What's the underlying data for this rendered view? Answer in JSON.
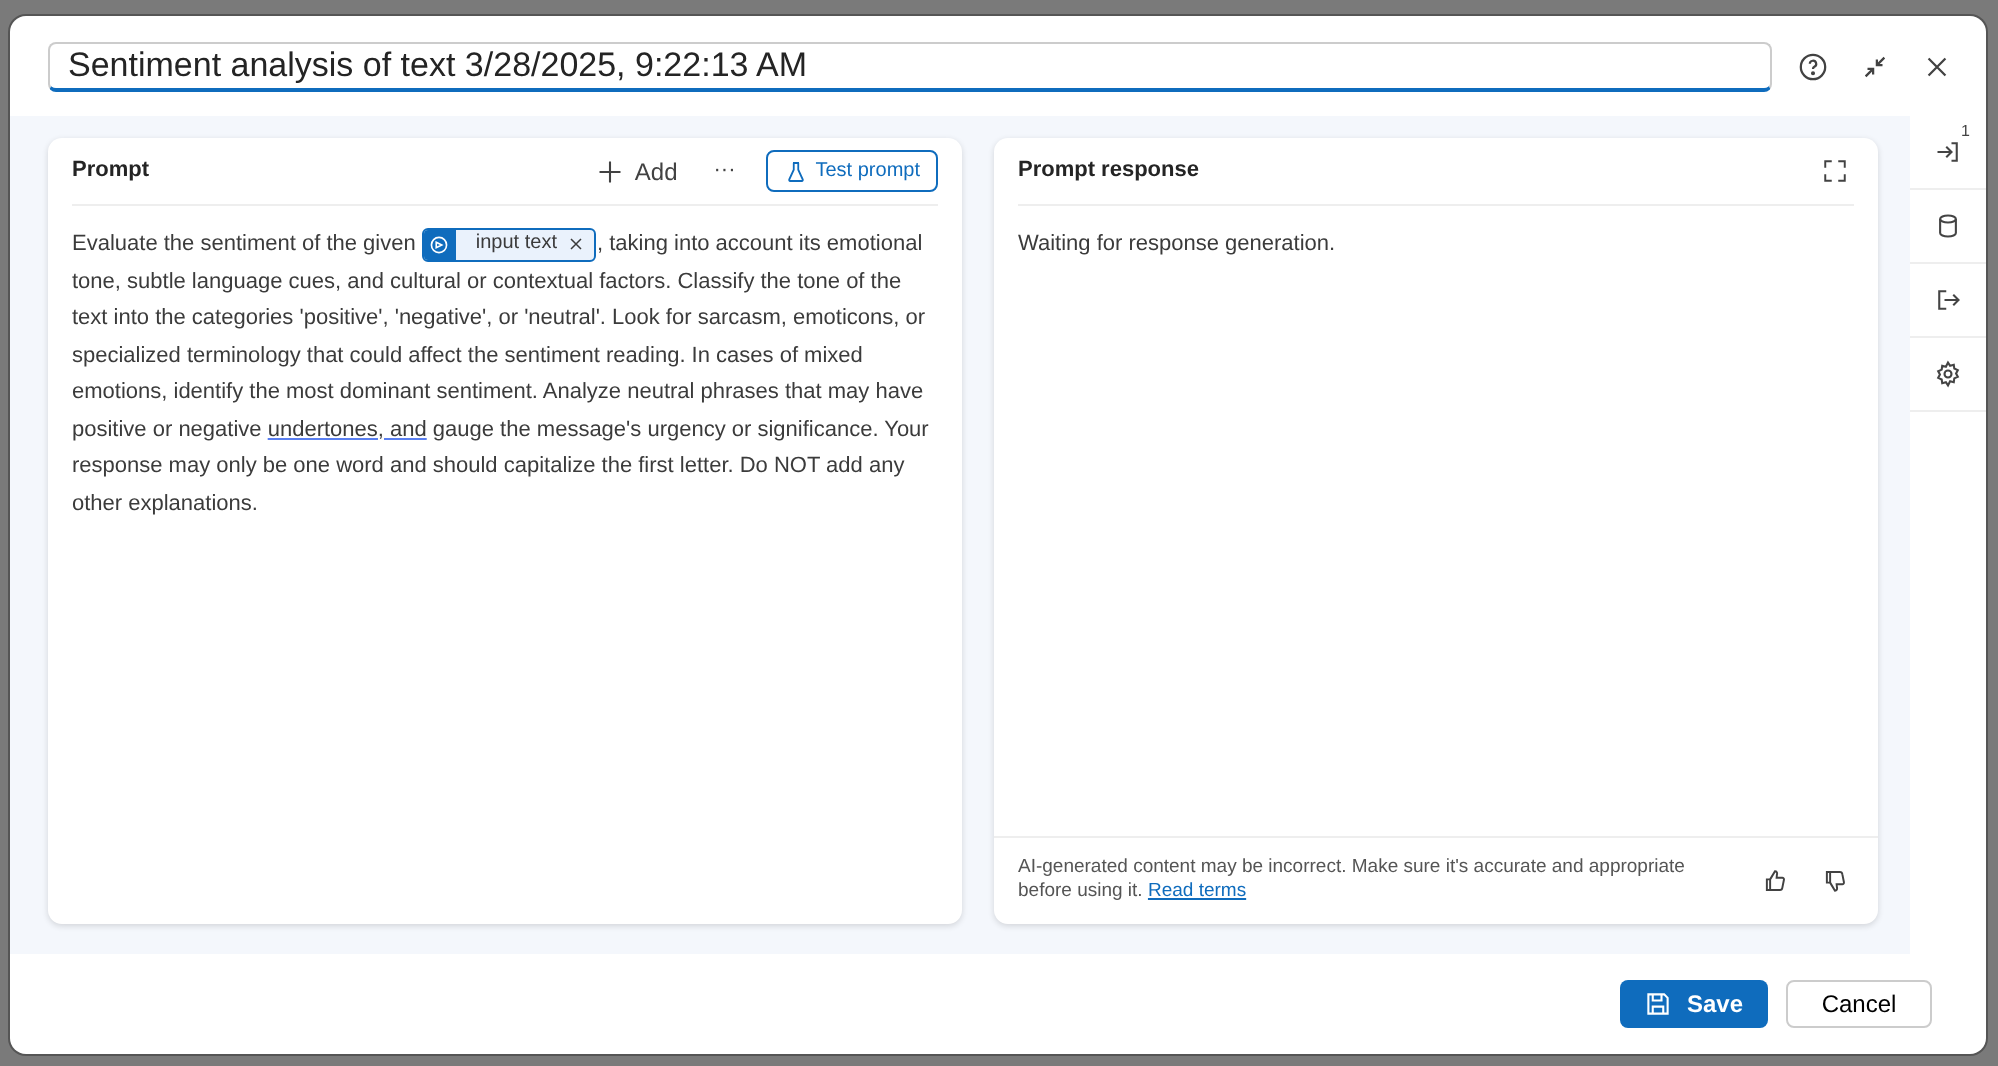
{
  "dialog": {
    "title_value": "Sentiment analysis of text 3/28/2025, 9:22:13 AM"
  },
  "prompt": {
    "title": "Prompt",
    "add_label": "Add",
    "more_label": "···",
    "test_label": "Test prompt",
    "text_before": "Evaluate the sentiment of the given ",
    "chip": "input text",
    "text_after": ", taking into account its emotional tone, subtle language cues, and cultural or contextual factors. Classify the tone of the text into the categories 'positive', 'negative', or 'neutral'. Look for sarcasm, emoticons, or specialized terminology that could affect the sentiment reading. In cases of mixed emotions, identify the most dominant sentiment. Analyze neutral phrases that may have positive or negative ",
    "underlined": "undertones, and",
    "text_end": " gauge the message's urgency or significance. Your response may only be one word and should capitalize the first letter. Do NOT add any other explanations."
  },
  "response": {
    "title": "Prompt response",
    "status": "Waiting for response generation.",
    "disclaimer": "AI-generated content may be incorrect. Make sure it's accurate and appropriate before using it.",
    "link": "Read terms"
  },
  "side_rail": [
    {
      "kind": "input",
      "badge": "1"
    },
    {
      "kind": "data"
    },
    {
      "kind": "output"
    },
    {
      "kind": "settings"
    }
  ],
  "buttons": {
    "save": "Save",
    "cancel": "Cancel"
  }
}
